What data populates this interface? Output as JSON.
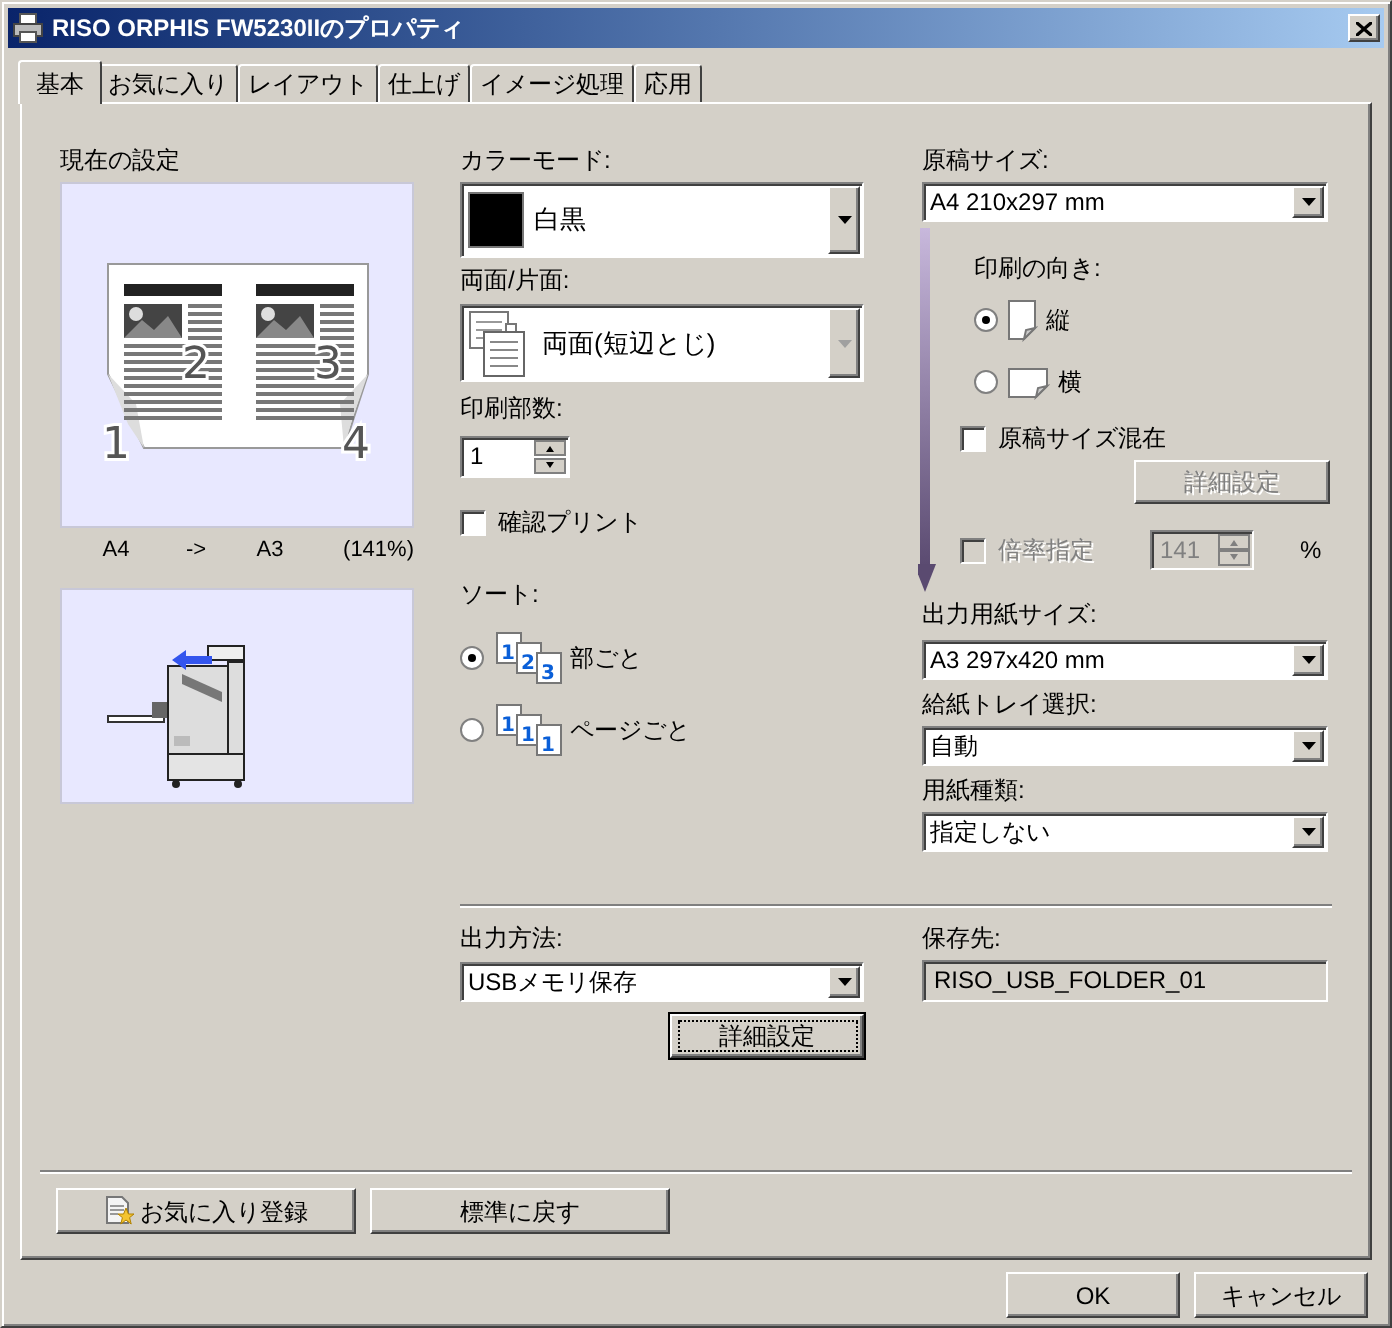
{
  "window": {
    "title": "RISO ORPHIS FW5230IIのプロパティ"
  },
  "tabs": [
    {
      "label": "基本",
      "selected": true
    },
    {
      "label": "お気に入り",
      "selected": false
    },
    {
      "label": "レイアウト",
      "selected": false
    },
    {
      "label": "仕上げ",
      "selected": false
    },
    {
      "label": "イメージ処理",
      "selected": false
    },
    {
      "label": "応用",
      "selected": false
    }
  ],
  "current_settings": {
    "label": "現在の設定",
    "page_numbers": [
      "1",
      "2",
      "3",
      "4"
    ],
    "caption": [
      "A4",
      "->",
      "A3",
      "(141%)"
    ]
  },
  "color_mode": {
    "label": "カラーモード:",
    "value": "白黒"
  },
  "duplex": {
    "label": "両面/片面:",
    "value": "両面(短辺とじ)",
    "disabled": true
  },
  "copies": {
    "label": "印刷部数:",
    "value": "1"
  },
  "proof_print": {
    "label": "確認プリント",
    "checked": false
  },
  "sort": {
    "label": "ソート:",
    "options": [
      {
        "label": "部ごと",
        "selected": true,
        "icon_digits": [
          "1",
          "2",
          "3"
        ]
      },
      {
        "label": "ページごと",
        "selected": false,
        "icon_digits": [
          "1",
          "1",
          "1"
        ]
      }
    ]
  },
  "original_size": {
    "label": "原稿サイズ:",
    "value": "A4 210x297 mm"
  },
  "orientation": {
    "label": "印刷の向き:",
    "options": [
      {
        "label": "縦",
        "kind": "portrait",
        "selected": true
      },
      {
        "label": "横",
        "kind": "landscape",
        "selected": false
      }
    ]
  },
  "mixed_sizes": {
    "label": "原稿サイズ混在",
    "checked": false
  },
  "mixed_details_button": {
    "label": "詳細設定",
    "disabled": true
  },
  "zoom": {
    "label": "倍率指定",
    "checked": false,
    "disabled": true,
    "value": "141",
    "unit": "%"
  },
  "output_paper_size": {
    "label": "出力用紙サイズ:",
    "value": "A3 297x420 mm"
  },
  "paper_tray": {
    "label": "給紙トレイ選択:",
    "value": "自動"
  },
  "paper_type": {
    "label": "用紙種類:",
    "value": "指定しない"
  },
  "output_method": {
    "label": "出力方法:",
    "value": "USBメモリ保存"
  },
  "output_details_button": {
    "label": "詳細設定",
    "focused": true
  },
  "save_to": {
    "label": "保存先:",
    "value": "RISO_USB_FOLDER_01"
  },
  "footer_buttons": [
    {
      "label": "お気に入り登録",
      "kind": "favorite"
    },
    {
      "label": "標準に戻す",
      "kind": "plain"
    }
  ],
  "dialog_buttons": [
    "OK",
    "キャンセル"
  ]
}
